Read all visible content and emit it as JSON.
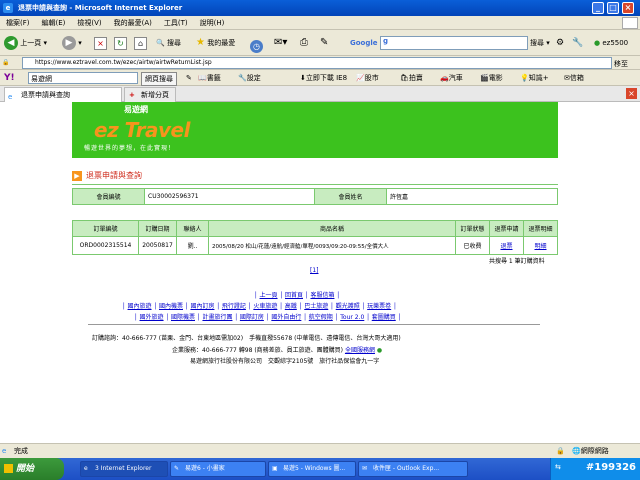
{
  "window": {
    "title": "退票申請與查詢 - Microsoft Internet Explorer",
    "min": "_",
    "max": "□",
    "close": "×"
  },
  "menu": [
    "檔案(F)",
    "編輯(E)",
    "檢視(V)",
    "我的最愛(A)",
    "工具(T)",
    "說明(H)"
  ],
  "toolbar": {
    "back": "上一頁",
    "search": "搜尋",
    "favorites": "我的最愛",
    "google_label": "Google",
    "google_input": "g",
    "search_btn": "搜尋",
    "user": "ez5500"
  },
  "address": {
    "url": "https://www.eztravel.com.tw/ezec/airtw/airtwReturnList.jsp",
    "go": "移至"
  },
  "yahoo_bar": {
    "logo": "Y!",
    "site": "易遊網",
    "web_search": "網頁搜尋",
    "items": [
      "書籤",
      "設定",
      "立即下載 IE8",
      "股市",
      "拍賣",
      "汽車",
      "電影",
      "知識+",
      "信箱"
    ]
  },
  "tabs": {
    "active": "退票申請與查詢",
    "new": "新增分頁"
  },
  "banner": {
    "brand_cn": "易遊網",
    "brand_en": "ez Travel",
    "slogan": "暢遊世界的夢想，在此實現！"
  },
  "page": {
    "section_title": "退票申請與查詢",
    "member_id_label": "會員編號",
    "member_id": "CU30002596371",
    "member_name_label": "會員姓名",
    "member_name": "許恆嘉",
    "order_headers": [
      "訂單編號",
      "訂購日期",
      "聯絡人",
      "商品名稱",
      "訂單狀態",
      "退票申請",
      "退票明細"
    ],
    "order": {
      "id": "ORD0002315514",
      "date": "20050817",
      "contact": "劉..",
      "product": "2005/08/20 松山/花蓮/遠航/經濟艙/單程/0093/09:20-09:55/全價大人",
      "status": "已收費",
      "refund": "退票",
      "detail": "明細"
    },
    "count_text": "共搜尋 1 筆訂購資料",
    "pager": "[1]"
  },
  "footer_nav": {
    "row1": [
      "上一頁",
      "回首頁",
      "客服信箱"
    ],
    "row2": [
      "國內旅遊",
      "國內機票",
      "國內訂房",
      "飛行證記",
      "火車旅遊",
      "高鐵",
      "巴士旅遊",
      "觀光護照",
      "玩樂票卷"
    ],
    "row3": [
      "國外旅遊",
      "國際機票",
      "計畫旅行團",
      "國際訂房",
      "國外自由行",
      "航空假期",
      "Tour 2.0",
      "套圖購買"
    ]
  },
  "footer": {
    "line1": "訂購諮詢：40-666-777 (苗栗、金門、台東地區需加02)　手機直撥55678 (中華電信、遠傳電信、台灣大哥大適用)",
    "line2_a": "企業服務：40-666-777 轉98 (商務差旅、員工旅遊、團體購買)",
    "line2_b": "全國服務網",
    "line3": "易遊網旅行社股份有限公司　交觀綜字2105號　旅行社品保協會九一字"
  },
  "status": {
    "left": "完成",
    "zone": "網際網路"
  },
  "taskbar": {
    "start": "開始",
    "tasks": [
      "3 Internet Explorer",
      "易遊6 - 小畫家",
      "易遊5 - Windows 圖...",
      "收件匣 - Outlook Exp..."
    ],
    "clock": "#199326"
  }
}
